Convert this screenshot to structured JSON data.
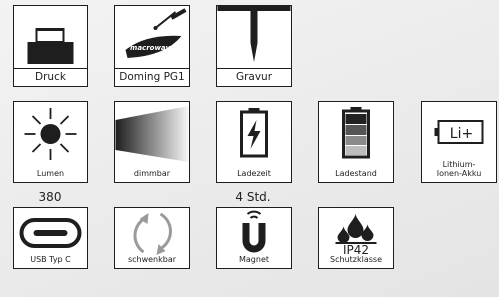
{
  "row1": {
    "druck": "Druck",
    "doming": "Doming PG1",
    "gravur": "Gravur"
  },
  "row2": {
    "lumen": "Lumen",
    "lumen_value": "380",
    "dimmbar": "dimmbar",
    "ladezeit": "Ladezeit",
    "ladezeit_value": "4 Std.",
    "ladestand": "Ladestand",
    "lithium_line1": "Lithium-",
    "lithium_line2": "Ionen-Akku",
    "li_symbol": "Li+"
  },
  "row3": {
    "usb": "USB Typ C",
    "schwenkbar": "schwenkbar",
    "magnet": "Magnet",
    "ip_code": "IP42",
    "schutzklasse": "Schutzklasse"
  },
  "doming_logo_text": "macrowave",
  "colors": {
    "border": "#1e1e1e",
    "icon": "#1e1e1e",
    "battery_levels": [
      "#222222",
      "#555555",
      "#8a8a8a",
      "#bdbdbd"
    ]
  },
  "icons": [
    "printer-icon",
    "doming-icon",
    "engraving-icon",
    "sun-icon",
    "dimming-icon",
    "charging-battery-icon",
    "battery-level-icon",
    "lithium-battery-icon",
    "usb-c-icon",
    "rotate-icon",
    "magnet-icon",
    "water-drops-icon"
  ]
}
